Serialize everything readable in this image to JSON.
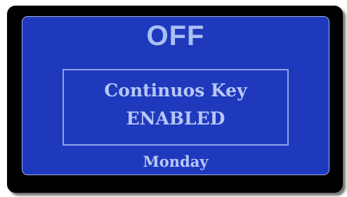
{
  "display": {
    "status": "OFF",
    "key_line1": "Continuos Key",
    "key_line2": "ENABLED",
    "day": "Monday"
  },
  "colors": {
    "bezel": "#000000",
    "screen": "#1f39bd",
    "text": "#b6c7f7"
  }
}
